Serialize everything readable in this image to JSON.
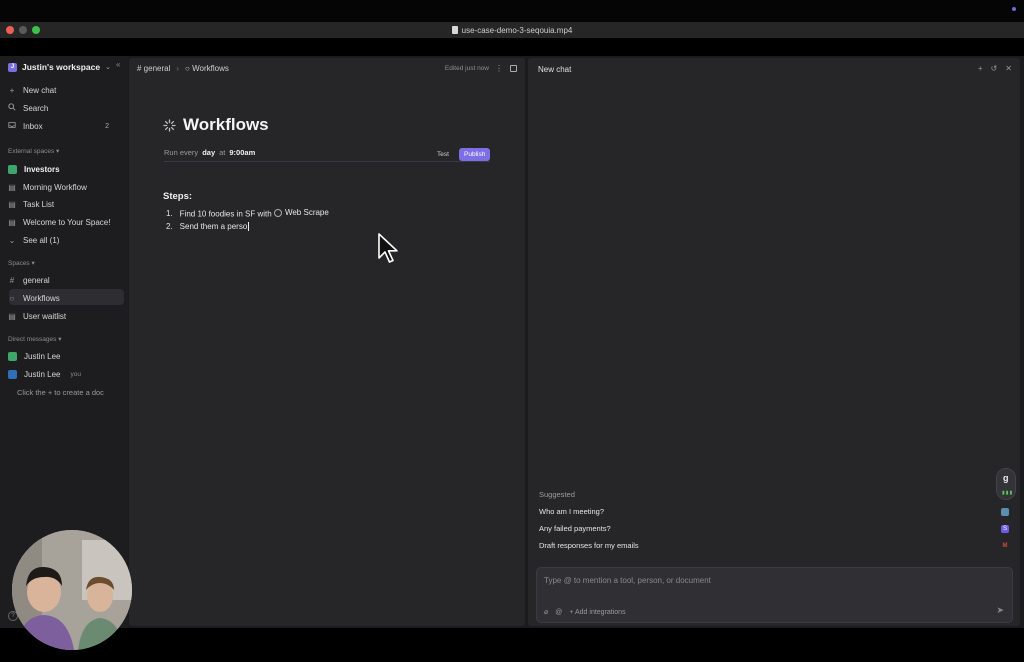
{
  "player": {
    "file_name": "use-case-demo-3-seqouia.mp4"
  },
  "sidebar": {
    "workspace_name": "Justin's workspace",
    "workspace_initial": "J",
    "items": [
      {
        "label": "New chat",
        "icon": "plus-icon"
      },
      {
        "label": "Search",
        "icon": "search-icon"
      },
      {
        "label": "Inbox",
        "icon": "inbox-icon",
        "count": "2"
      }
    ],
    "external_spaces_label": "External spaces",
    "external_space": {
      "name": "Investors",
      "color": "#3fa66b"
    },
    "external_docs": [
      "Morning Workflow",
      "Task List",
      "Welcome to Your Space!"
    ],
    "see_all_label": "See all (1)",
    "spaces_label": "Spaces",
    "spaces": [
      {
        "label": "general",
        "icon": "hash-icon"
      },
      {
        "label": "Workflows",
        "icon": "workflow-icon",
        "active": true
      },
      {
        "label": "User waitlist",
        "icon": "document-icon"
      }
    ],
    "dm_label": "Direct messages",
    "dms": [
      {
        "name": "Justin Lee",
        "suffix": "",
        "color": "#3fa66b"
      },
      {
        "name": "Justin Lee",
        "suffix": "you",
        "color": "#2f6fb5"
      }
    ],
    "hint": "Click the + to create a doc"
  },
  "doc": {
    "breadcrumb_channel": "general",
    "breadcrumb_page": "Workflows",
    "edited": "Edited just now",
    "title": "Workflows",
    "run_prefix": "Run every",
    "run_freq": "day",
    "run_at": "at",
    "run_time": "9:00am",
    "test_label": "Test",
    "publish_label": "Publish",
    "accent_color": "#7c6fe6",
    "steps_label": "Steps:",
    "steps": [
      {
        "num": "1.",
        "text": "Find 10 foodies in SF with",
        "tool": "Web Scrape"
      },
      {
        "num": "2.",
        "text": "Send them a perso"
      }
    ]
  },
  "chat": {
    "title": "New chat",
    "suggested_label": "Suggested",
    "suggestions": [
      {
        "text": "Who am I meeting?",
        "icon": "calendar-icon",
        "color": "#5b8fb0"
      },
      {
        "text": "Any failed payments?",
        "icon": "stripe-icon",
        "color": "#6c5ce7"
      },
      {
        "text": "Draft responses for my emails",
        "icon": "gmail-icon",
        "color": "#d44638"
      }
    ],
    "input_placeholder": "Type @ to mention a tool, person, or document",
    "add_integrations": "Add integrations",
    "side_pill_letter": "g"
  }
}
